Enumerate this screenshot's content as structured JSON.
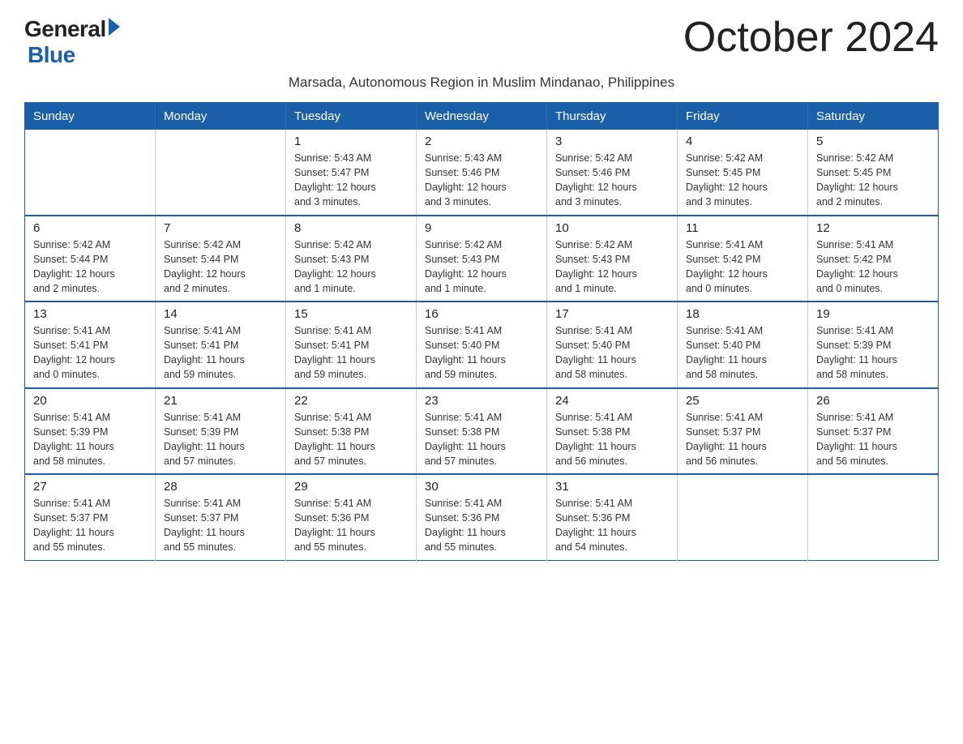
{
  "logo": {
    "general": "General",
    "blue": "Blue"
  },
  "title": "October 2024",
  "subtitle": "Marsada, Autonomous Region in Muslim Mindanao, Philippines",
  "weekdays": [
    "Sunday",
    "Monday",
    "Tuesday",
    "Wednesday",
    "Thursday",
    "Friday",
    "Saturday"
  ],
  "weeks": [
    [
      {
        "day": "",
        "info": ""
      },
      {
        "day": "",
        "info": ""
      },
      {
        "day": "1",
        "info": "Sunrise: 5:43 AM\nSunset: 5:47 PM\nDaylight: 12 hours\nand 3 minutes."
      },
      {
        "day": "2",
        "info": "Sunrise: 5:43 AM\nSunset: 5:46 PM\nDaylight: 12 hours\nand 3 minutes."
      },
      {
        "day": "3",
        "info": "Sunrise: 5:42 AM\nSunset: 5:46 PM\nDaylight: 12 hours\nand 3 minutes."
      },
      {
        "day": "4",
        "info": "Sunrise: 5:42 AM\nSunset: 5:45 PM\nDaylight: 12 hours\nand 3 minutes."
      },
      {
        "day": "5",
        "info": "Sunrise: 5:42 AM\nSunset: 5:45 PM\nDaylight: 12 hours\nand 2 minutes."
      }
    ],
    [
      {
        "day": "6",
        "info": "Sunrise: 5:42 AM\nSunset: 5:44 PM\nDaylight: 12 hours\nand 2 minutes."
      },
      {
        "day": "7",
        "info": "Sunrise: 5:42 AM\nSunset: 5:44 PM\nDaylight: 12 hours\nand 2 minutes."
      },
      {
        "day": "8",
        "info": "Sunrise: 5:42 AM\nSunset: 5:43 PM\nDaylight: 12 hours\nand 1 minute."
      },
      {
        "day": "9",
        "info": "Sunrise: 5:42 AM\nSunset: 5:43 PM\nDaylight: 12 hours\nand 1 minute."
      },
      {
        "day": "10",
        "info": "Sunrise: 5:42 AM\nSunset: 5:43 PM\nDaylight: 12 hours\nand 1 minute."
      },
      {
        "day": "11",
        "info": "Sunrise: 5:41 AM\nSunset: 5:42 PM\nDaylight: 12 hours\nand 0 minutes."
      },
      {
        "day": "12",
        "info": "Sunrise: 5:41 AM\nSunset: 5:42 PM\nDaylight: 12 hours\nand 0 minutes."
      }
    ],
    [
      {
        "day": "13",
        "info": "Sunrise: 5:41 AM\nSunset: 5:41 PM\nDaylight: 12 hours\nand 0 minutes."
      },
      {
        "day": "14",
        "info": "Sunrise: 5:41 AM\nSunset: 5:41 PM\nDaylight: 11 hours\nand 59 minutes."
      },
      {
        "day": "15",
        "info": "Sunrise: 5:41 AM\nSunset: 5:41 PM\nDaylight: 11 hours\nand 59 minutes."
      },
      {
        "day": "16",
        "info": "Sunrise: 5:41 AM\nSunset: 5:40 PM\nDaylight: 11 hours\nand 59 minutes."
      },
      {
        "day": "17",
        "info": "Sunrise: 5:41 AM\nSunset: 5:40 PM\nDaylight: 11 hours\nand 58 minutes."
      },
      {
        "day": "18",
        "info": "Sunrise: 5:41 AM\nSunset: 5:40 PM\nDaylight: 11 hours\nand 58 minutes."
      },
      {
        "day": "19",
        "info": "Sunrise: 5:41 AM\nSunset: 5:39 PM\nDaylight: 11 hours\nand 58 minutes."
      }
    ],
    [
      {
        "day": "20",
        "info": "Sunrise: 5:41 AM\nSunset: 5:39 PM\nDaylight: 11 hours\nand 58 minutes."
      },
      {
        "day": "21",
        "info": "Sunrise: 5:41 AM\nSunset: 5:39 PM\nDaylight: 11 hours\nand 57 minutes."
      },
      {
        "day": "22",
        "info": "Sunrise: 5:41 AM\nSunset: 5:38 PM\nDaylight: 11 hours\nand 57 minutes."
      },
      {
        "day": "23",
        "info": "Sunrise: 5:41 AM\nSunset: 5:38 PM\nDaylight: 11 hours\nand 57 minutes."
      },
      {
        "day": "24",
        "info": "Sunrise: 5:41 AM\nSunset: 5:38 PM\nDaylight: 11 hours\nand 56 minutes."
      },
      {
        "day": "25",
        "info": "Sunrise: 5:41 AM\nSunset: 5:37 PM\nDaylight: 11 hours\nand 56 minutes."
      },
      {
        "day": "26",
        "info": "Sunrise: 5:41 AM\nSunset: 5:37 PM\nDaylight: 11 hours\nand 56 minutes."
      }
    ],
    [
      {
        "day": "27",
        "info": "Sunrise: 5:41 AM\nSunset: 5:37 PM\nDaylight: 11 hours\nand 55 minutes."
      },
      {
        "day": "28",
        "info": "Sunrise: 5:41 AM\nSunset: 5:37 PM\nDaylight: 11 hours\nand 55 minutes."
      },
      {
        "day": "29",
        "info": "Sunrise: 5:41 AM\nSunset: 5:36 PM\nDaylight: 11 hours\nand 55 minutes."
      },
      {
        "day": "30",
        "info": "Sunrise: 5:41 AM\nSunset: 5:36 PM\nDaylight: 11 hours\nand 55 minutes."
      },
      {
        "day": "31",
        "info": "Sunrise: 5:41 AM\nSunset: 5:36 PM\nDaylight: 11 hours\nand 54 minutes."
      },
      {
        "day": "",
        "info": ""
      },
      {
        "day": "",
        "info": ""
      }
    ]
  ]
}
